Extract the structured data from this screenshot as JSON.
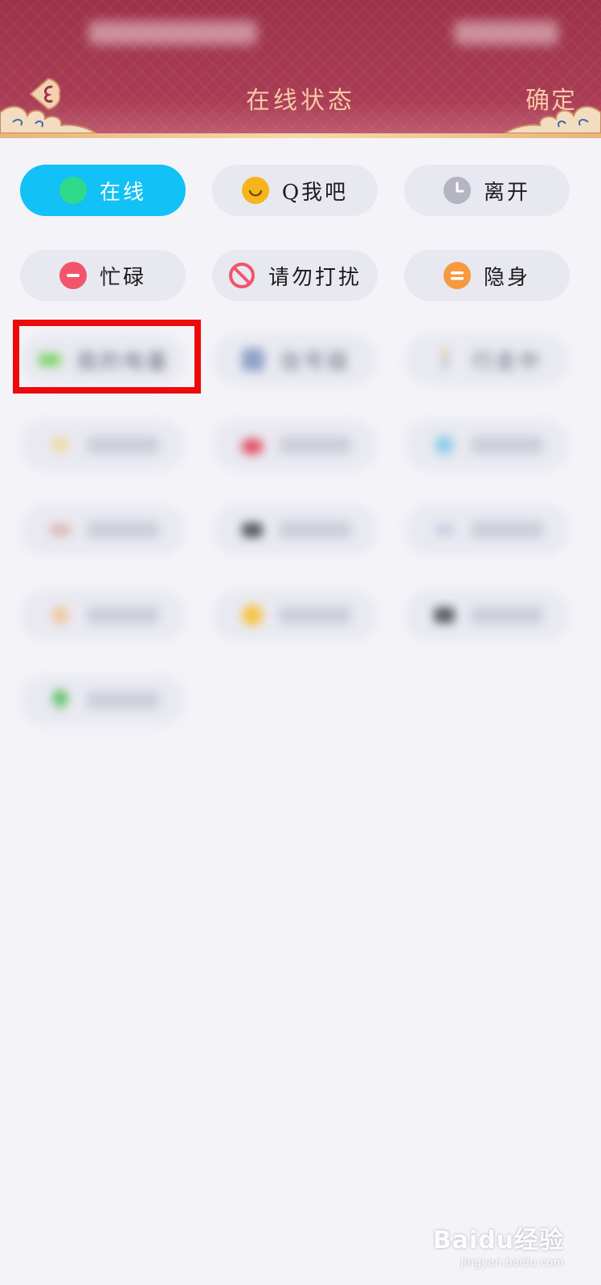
{
  "header": {
    "title": "在线状态",
    "confirm_label": "确定",
    "colors": {
      "background": "#a63a52",
      "title": "#f6c9a4",
      "trim": "#e8b57a"
    }
  },
  "statuses": [
    {
      "label": "在线",
      "icon": "green-dot-icon",
      "selected": true
    },
    {
      "label": "Q我吧",
      "icon": "smiley-icon",
      "selected": false
    },
    {
      "label": "离开",
      "icon": "clock-icon",
      "selected": false
    },
    {
      "label": "忙碌",
      "icon": "minus-circle-icon",
      "selected": false
    },
    {
      "label": "请勿打扰",
      "icon": "no-entry-icon",
      "selected": false
    },
    {
      "label": "隐身",
      "icon": "equals-circle-icon",
      "selected": false
    }
  ],
  "custom_statuses": [
    {
      "label": "我的电量",
      "icon": "battery-icon"
    },
    {
      "label": "信号弱",
      "icon": "signal-icon"
    },
    {
      "label": "行走中",
      "icon": "walking-icon"
    }
  ],
  "highlight_color": "#ee0a0a",
  "active_color": "#12c1f5",
  "watermark": {
    "main": "Baidu经验",
    "sub": "jingyan.baidu.com"
  }
}
